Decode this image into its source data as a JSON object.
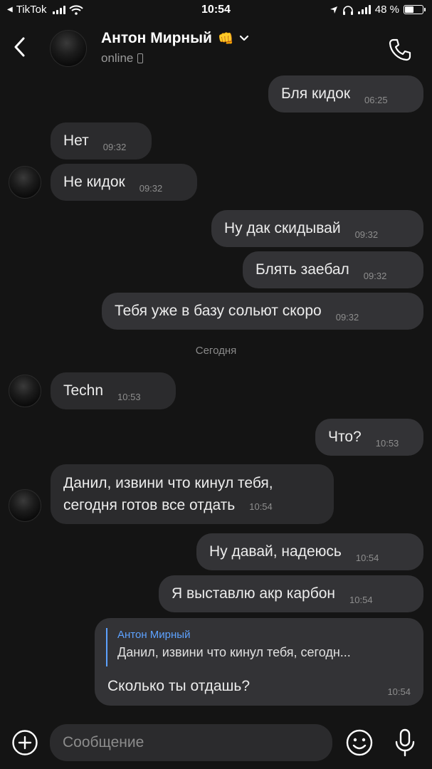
{
  "status_bar": {
    "back_app": "TikTok",
    "time": "10:54",
    "battery": "48 %",
    "battery_level": 0.48
  },
  "header": {
    "contact_name": "Антон Мирный",
    "name_emoji": "👊",
    "status": "online",
    "icons": [
      "chevron-left-icon",
      "chevron-down-icon",
      "phone-icon"
    ]
  },
  "messages": [
    {
      "dir": "out",
      "text": "Бля кидок",
      "time": "06:25"
    },
    {
      "dir": "in",
      "text": "Нет",
      "time": "09:32"
    },
    {
      "dir": "in",
      "text": "Не кидок",
      "time": "09:32"
    },
    {
      "dir": "out",
      "text": "Ну дак скидывай",
      "time": "09:32"
    },
    {
      "dir": "out",
      "text": "Блять заебал",
      "time": "09:32"
    },
    {
      "dir": "out",
      "text": "Тебя уже в базу сольют скоро",
      "time": "09:32"
    },
    {
      "dir": "in",
      "text": "Techn",
      "time": "10:53"
    },
    {
      "dir": "out",
      "text": "Что?",
      "time": "10:53"
    },
    {
      "dir": "in",
      "line1": "Данил, извини что кинул тебя,",
      "line2": "сегодня готов все отдать",
      "time": "10:54"
    },
    {
      "dir": "out",
      "text": "Ну давай, надеюсь",
      "time": "10:54"
    },
    {
      "dir": "out",
      "text": "Я выставлю акр карбон",
      "time": "10:54"
    }
  ],
  "date_separator": "Сегодня",
  "reply": {
    "quote_name": "Антон Мирный",
    "quote_text": "Данил, извини что кинул тебя, сегодн...",
    "text": "Сколько ты отдашь?",
    "time": "10:54"
  },
  "input": {
    "placeholder": "Сообщение"
  },
  "colors": {
    "background": "#141414",
    "bubble_in": "#2b2b2d",
    "bubble_out": "#333336",
    "accent": "#5da2ff"
  }
}
